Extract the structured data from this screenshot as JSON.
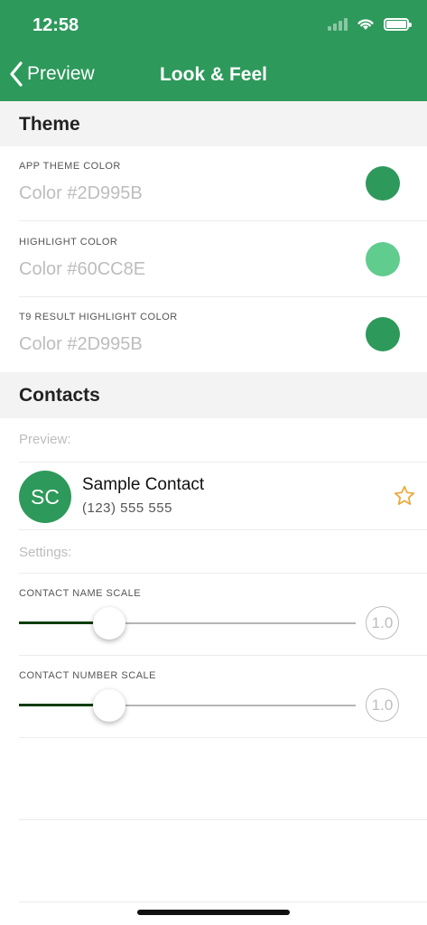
{
  "status_bar": {
    "time": "12:58"
  },
  "nav": {
    "back_label": "Preview",
    "title": "Look & Feel"
  },
  "theme": {
    "title": "Theme",
    "colors": [
      {
        "label": "APP THEME COLOR",
        "value": "Color #2D995B",
        "hex": "#2D995B"
      },
      {
        "label": "HIGHLIGHT COLOR",
        "value": "Color #60CC8E",
        "hex": "#60CC8E"
      },
      {
        "label": "T9 RESULT HIGHLIGHT COLOR",
        "value": "Color #2D995B",
        "hex": "#2D995B"
      }
    ]
  },
  "contacts": {
    "title": "Contacts",
    "preview_label": "Preview:",
    "sample": {
      "initials": "SC",
      "name": "Sample Contact",
      "number": "(123) 555 555"
    },
    "settings_label": "Settings:",
    "name_scale": {
      "label": "CONTACT NAME SCALE",
      "value": "1.0",
      "fraction": 0.23
    },
    "number_scale": {
      "label": "CONTACT NUMBER SCALE",
      "value": "1.0",
      "fraction": 0.23
    }
  },
  "colors": {
    "header": "#2D995B",
    "star": "#E8A93A"
  }
}
